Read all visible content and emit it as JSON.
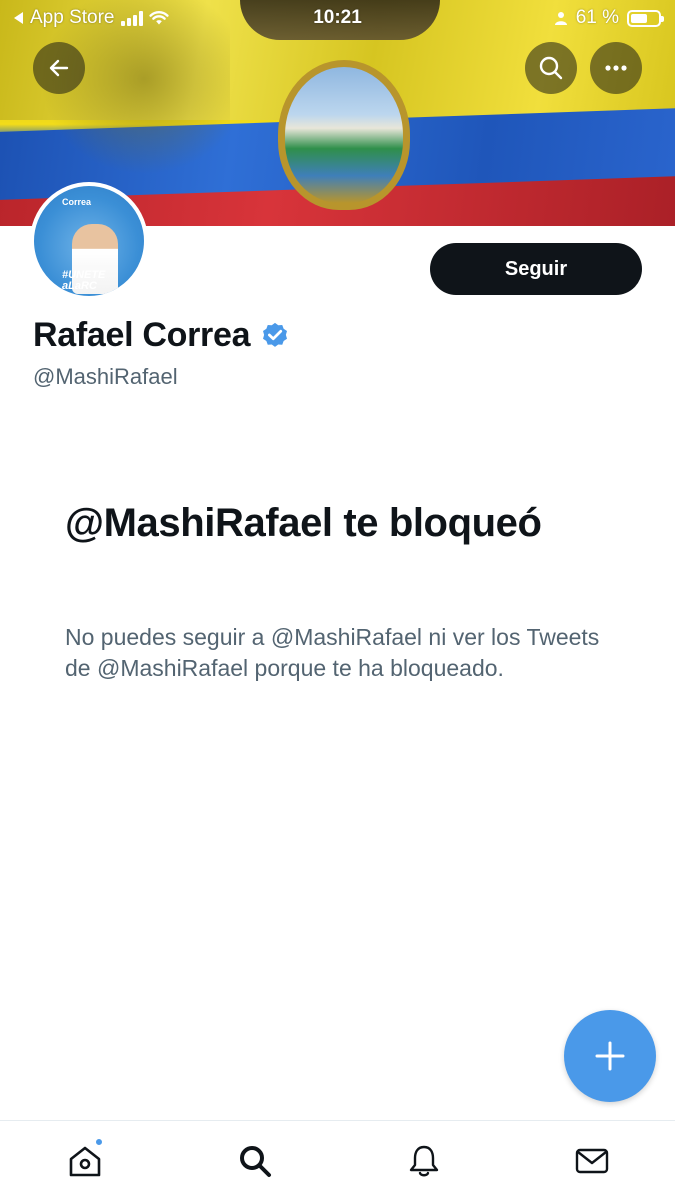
{
  "status_bar": {
    "back_app": "App Store",
    "time": "10:21",
    "battery": "61 %",
    "battery_level": 0.61
  },
  "profile": {
    "name": "Rafael Correa",
    "handle": "@MashiRafael",
    "verified": true,
    "follow_label": "Seguir",
    "avatar_text": {
      "logo": "Correa",
      "slogan_line1": "#UNETE",
      "slogan_line2": "aLaRC"
    }
  },
  "blocked": {
    "title": "@MashiRafael te bloqueó",
    "message": "No puedes seguir a @MashiRafael ni ver los Tweets de @MashiRafael porque te ha bloqueado."
  },
  "icons": {
    "back": "arrow-left-icon",
    "search": "search-icon",
    "more": "more-horizontal-icon",
    "compose": "plus-icon",
    "tabs": [
      "home-icon",
      "search-icon",
      "bell-icon",
      "mail-icon"
    ]
  },
  "colors": {
    "accent": "#4a99e9",
    "text_primary": "#0f1419",
    "text_secondary": "#536471",
    "button_dark": "#0f1419"
  }
}
